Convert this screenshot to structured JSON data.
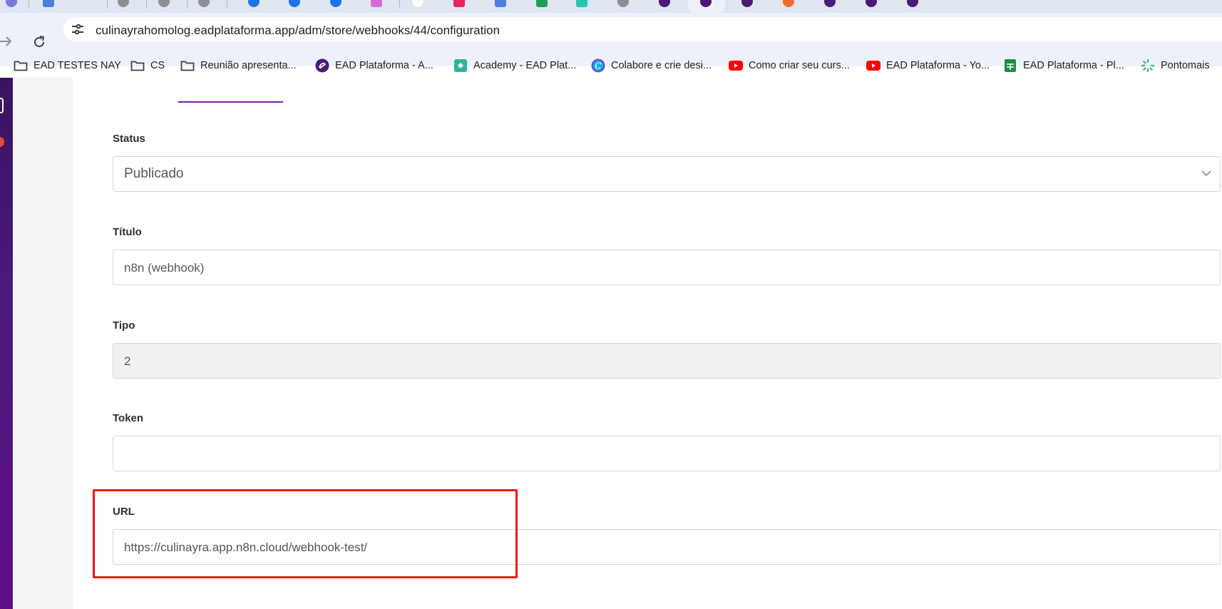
{
  "browser": {
    "url": "culinayrahomolog.eadplataforma.app/adm/store/webhooks/44/configuration",
    "bookmarks": [
      {
        "label": "EAD TESTES NAY",
        "icon": "folder-icon"
      },
      {
        "label": "CS",
        "icon": "folder-icon"
      },
      {
        "label": "Reunião apresenta...",
        "icon": "folder-icon"
      },
      {
        "label": "EAD Plataforma - A...",
        "icon": "ead-logo-icon"
      },
      {
        "label": "Academy - EAD Plat...",
        "icon": "academy-icon"
      },
      {
        "label": "Colabore e crie desi...",
        "icon": "canva-icon"
      },
      {
        "label": "Como criar seu curs...",
        "icon": "youtube-icon"
      },
      {
        "label": "EAD Plataforma - Yo...",
        "icon": "youtube-icon"
      },
      {
        "label": "EAD Plataforma - Pl...",
        "icon": "sheets-icon"
      },
      {
        "label": "Pontomais",
        "icon": "pontomais-icon"
      }
    ]
  },
  "colors": {
    "accent": "#7b1fa2",
    "sidebar": "#4a1a78",
    "highlight": "#f01818"
  },
  "form": {
    "status": {
      "label": "Status",
      "value": "Publicado"
    },
    "title": {
      "label": "Título",
      "value": "n8n (webhook)"
    },
    "type": {
      "label": "Tipo",
      "value": "2"
    },
    "token": {
      "label": "Token",
      "value": ""
    },
    "url": {
      "label": "URL",
      "value": "https://culinayra.app.n8n.cloud/webhook-test/"
    }
  }
}
